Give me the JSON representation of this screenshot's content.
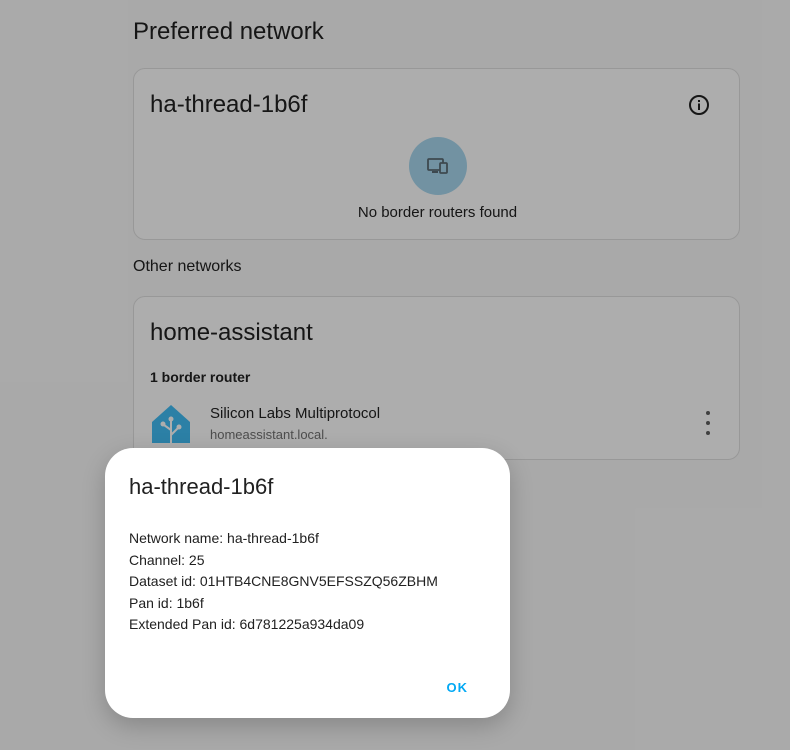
{
  "preferred": {
    "section_title": "Preferred network",
    "network_name": "ha-thread-1b6f",
    "empty_text": "No border routers found"
  },
  "other": {
    "section_title": "Other networks",
    "network_name": "home-assistant",
    "subheader": "1 border router",
    "routers": [
      {
        "name": "Silicon Labs Multiprotocol",
        "host": "homeassistant.local."
      }
    ]
  },
  "dialog": {
    "title": "ha-thread-1b6f",
    "lines": [
      "Network name: ha-thread-1b6f",
      "Channel: 25",
      "Dataset id: 01HTB4CNE8GNV5EFSSZQ56ZBHM",
      "Pan id: 1b6f",
      "Extended Pan id: 6d781225a934da09"
    ],
    "ok_label": "OK"
  },
  "icons": {
    "info": "info-icon",
    "empty_state": "devices-icon",
    "router_logo": "home-assistant-logo",
    "more": "more-vertical-icon"
  },
  "colors": {
    "accent": "#03a9f4",
    "empty_state_bg": "#a8d8ef",
    "logo": "#41bdf5"
  }
}
